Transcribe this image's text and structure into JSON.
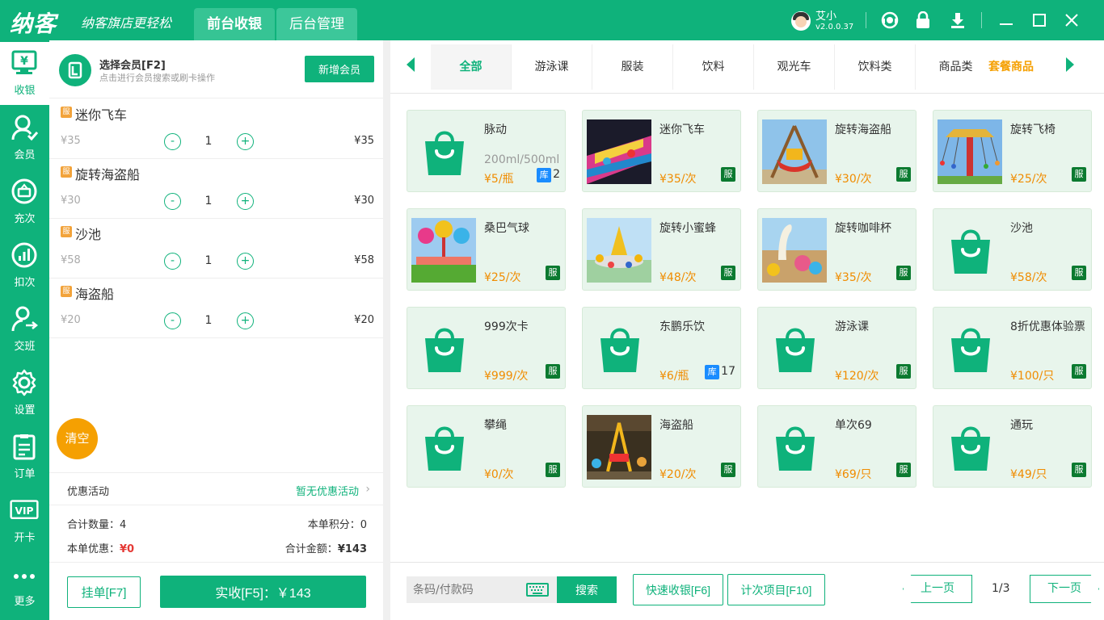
{
  "app": {
    "logo": "纳客",
    "slogan": "纳客旗店更轻松"
  },
  "nav": {
    "front": "前台收银",
    "back": "后台管理"
  },
  "user": {
    "name": "艾小",
    "version": "v2.0.0.37"
  },
  "topbar_icons": [
    "support-icon",
    "lock-icon",
    "download-icon",
    "minimize-icon",
    "maximize-icon",
    "close-icon"
  ],
  "sidebar": {
    "items": [
      {
        "label": "收银",
        "icon": "cash-register-icon",
        "active": true
      },
      {
        "label": "会员",
        "icon": "member-icon"
      },
      {
        "label": "充次",
        "icon": "recharge-icon"
      },
      {
        "label": "扣次",
        "icon": "deduct-icon"
      },
      {
        "label": "交班",
        "icon": "shift-icon"
      },
      {
        "label": "设置",
        "icon": "gear-icon"
      },
      {
        "label": "订单",
        "icon": "order-icon"
      },
      {
        "label": "开卡",
        "icon": "vip-card-icon",
        "badge": "VIP"
      },
      {
        "label": "更多",
        "icon": "more-icon"
      }
    ]
  },
  "member": {
    "title": "选择会员[F2]",
    "hint": "点击进行会员搜索或刷卡操作",
    "add_button": "新增会员"
  },
  "cart": {
    "tag": "服",
    "items": [
      {
        "name": "迷你飞车",
        "unit_price": "¥35",
        "qty": "1",
        "total": "¥35"
      },
      {
        "name": "旋转海盗船",
        "unit_price": "¥30",
        "qty": "1",
        "total": "¥30"
      },
      {
        "name": "沙池",
        "unit_price": "¥58",
        "qty": "1",
        "total": "¥58"
      },
      {
        "name": "海盗船",
        "unit_price": "¥20",
        "qty": "1",
        "total": "¥20"
      }
    ],
    "minus": "-",
    "plus": "+",
    "clear": "清空"
  },
  "promo": {
    "label": "优惠活动",
    "value": "暂无优惠活动"
  },
  "summary": {
    "count_label": "合计数量：",
    "count_value": "4",
    "points_label": "本单积分：",
    "points_value": "0",
    "discount_label": "本单优惠：",
    "discount_value": "¥0",
    "total_label": "合计金额：",
    "total_value": "¥143"
  },
  "actions": {
    "hold": "挂单[F7]",
    "pay": "实收[F5]：￥143"
  },
  "categories": {
    "tabs": [
      "全部",
      "游泳课",
      "服装",
      "饮料",
      "观光车",
      "饮料类",
      "商品类"
    ],
    "overflow": "套餐商品",
    "active": 0
  },
  "products": [
    {
      "name": "脉动",
      "spec": "200ml/500ml",
      "price": "¥5/瓶",
      "stock_tag": "库",
      "stock": "2",
      "image": "bag"
    },
    {
      "name": "迷你飞车",
      "price": "¥35/次",
      "badge": "服",
      "image": "photo-kart"
    },
    {
      "name": "旋转海盗船",
      "price": "¥30/次",
      "badge": "服",
      "image": "photo-pirate-ship"
    },
    {
      "name": "旋转飞椅",
      "price": "¥25/次",
      "badge": "服",
      "image": "photo-swing"
    },
    {
      "name": "桑巴气球",
      "price": "¥25/次",
      "badge": "服",
      "image": "photo-balloon"
    },
    {
      "name": "旋转小蜜蜂",
      "price": "¥48/次",
      "badge": "服",
      "image": "photo-bee"
    },
    {
      "name": "旋转咖啡杯",
      "price": "¥35/次",
      "badge": "服",
      "image": "photo-cups"
    },
    {
      "name": "沙池",
      "price": "¥58/次",
      "badge": "服",
      "image": "bag"
    },
    {
      "name": "999次卡",
      "price": "¥999/次",
      "badge": "服",
      "image": "bag"
    },
    {
      "name": "东鹏乐饮",
      "price": "¥6/瓶",
      "stock_tag": "库",
      "stock": "17",
      "image": "bag"
    },
    {
      "name": "游泳课",
      "price": "¥120/次",
      "badge": "服",
      "image": "bag"
    },
    {
      "name": "8折优惠体验票",
      "price": "¥100/只",
      "badge": "服",
      "image": "bag"
    },
    {
      "name": "攀绳",
      "price": "¥0/次",
      "badge": "服",
      "image": "bag"
    },
    {
      "name": "海盗船",
      "price": "¥20/次",
      "badge": "服",
      "image": "photo-indoor"
    },
    {
      "name": "单次69",
      "price": "¥69/只",
      "badge": "服",
      "image": "bag"
    },
    {
      "name": "通玩",
      "price": "¥49/只",
      "badge": "服",
      "image": "bag"
    }
  ],
  "bottom": {
    "barcode_placeholder": "条码/付款码",
    "search": "搜索",
    "quick": "快速收银[F6]",
    "count": "计次项目[F10]",
    "prev": "上一页",
    "next": "下一页",
    "page": "1/3"
  },
  "colors": {
    "brand": "#0fb27b",
    "price": "#f08c00",
    "accent": "#f5a002",
    "danger": "#e53935"
  }
}
